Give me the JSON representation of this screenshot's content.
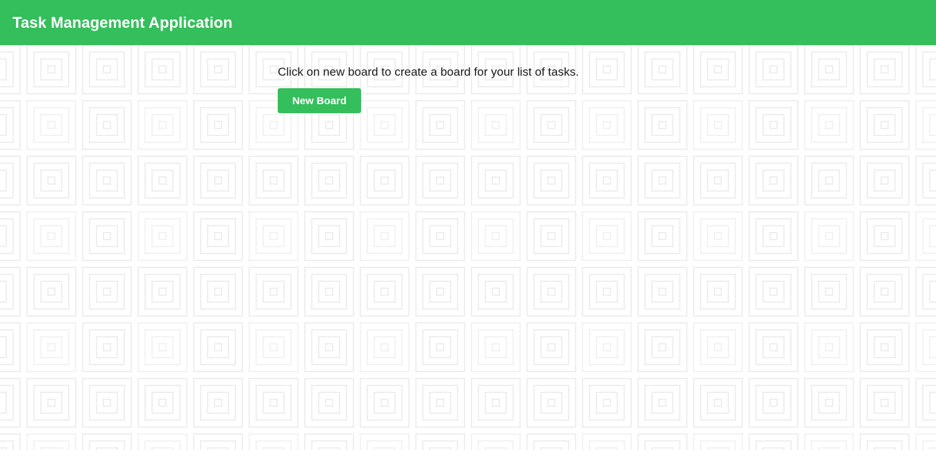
{
  "header": {
    "title": "Task Management Application",
    "background_color": "#34be5c"
  },
  "main": {
    "instruction": "Click on new board to create a board for your list of tasks.",
    "new_board_label": "New Board"
  },
  "background": {
    "pattern": "nested-squares",
    "line_color": "#f0f0f0"
  }
}
